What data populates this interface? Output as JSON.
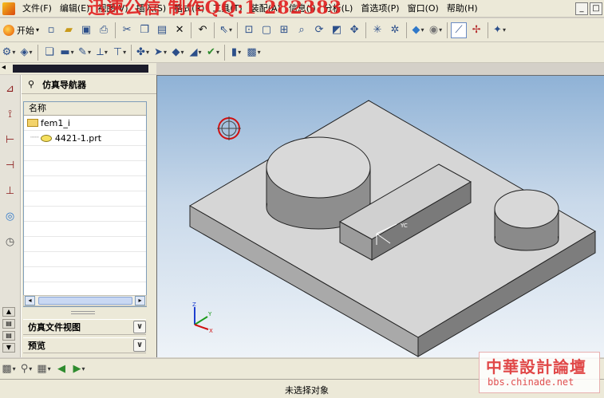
{
  "watermark": "迅速公信 制作QQ:1 282383",
  "menu": {
    "items": [
      "文件(F)",
      "编辑(E)",
      "视图(V)",
      "插入(S)",
      "格式(R)",
      "工具(T)",
      "装配(A)",
      "信息(I)",
      "分析(L)",
      "首选项(P)",
      "窗口(O)",
      "帮助(H)"
    ]
  },
  "window_controls": [
    "_",
    "□"
  ],
  "toolbar": {
    "start_label": "开始",
    "start_drop": "▾"
  },
  "navigator": {
    "title": "仿真导航器",
    "column_header": "名称",
    "tree": [
      {
        "label": "fem1_i",
        "level": 0
      },
      {
        "label": "4421-1.prt",
        "level": 1
      }
    ],
    "sections": [
      "仿真文件视图",
      "预览"
    ]
  },
  "viewport": {
    "wcs_label": "YC",
    "triad": {
      "x": "X",
      "y": "Y",
      "z": "Z"
    }
  },
  "status": {
    "text": "未选择对象"
  },
  "logo": {
    "name": "中華設計論壇",
    "url": "bbs.chinade.net"
  },
  "colors": {
    "accent": "#3a6ea5",
    "model_face_top": "#d4d4d4",
    "model_face_left": "#a8a8a8",
    "model_face_right": "#7b7b7b",
    "watermark": "#e11d1d"
  }
}
